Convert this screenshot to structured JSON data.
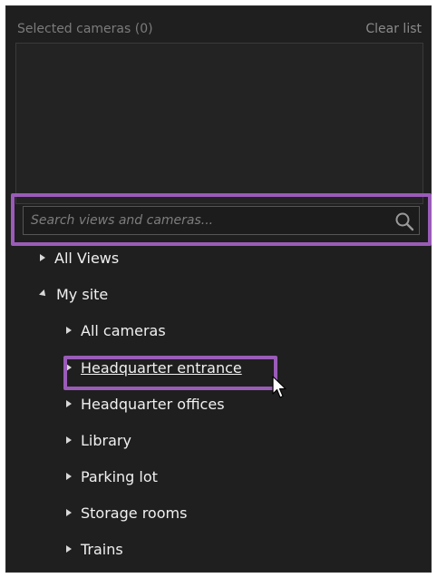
{
  "header": {
    "selected_label": "Selected cameras (0)",
    "clear_label": "Clear list"
  },
  "search": {
    "placeholder": "Search views and cameras..."
  },
  "tree": {
    "all_views": "All Views",
    "my_site": "My site",
    "children": {
      "all_cameras": "All cameras",
      "hq_entrance": "Headquarter entrance",
      "hq_offices": "Headquarter offices",
      "library": "Library",
      "parking": "Parking lot",
      "storage": "Storage rooms",
      "trains": "Trains"
    }
  },
  "colors": {
    "panel_bg": "#1f1f1f",
    "highlight": "#9a5cb8",
    "text": "#f0f0f0",
    "muted": "#7b7b7b"
  },
  "icons": {
    "search": "search-icon",
    "expand": "chevron-right-icon",
    "collapse": "chevron-down-icon",
    "cursor": "mouse-pointer-icon"
  }
}
